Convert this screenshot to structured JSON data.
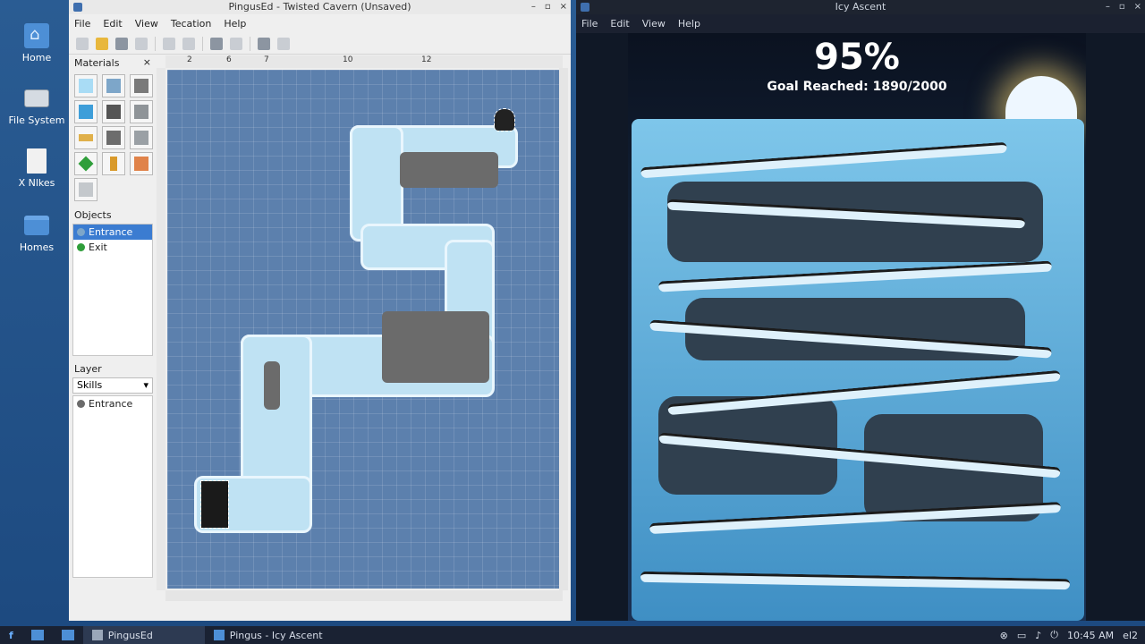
{
  "desktop": {
    "icons": [
      {
        "label": "Home",
        "icon": "home-icon"
      },
      {
        "label": "File System",
        "icon": "drive-icon"
      },
      {
        "label": "X Nlkes",
        "icon": "file-icon"
      },
      {
        "label": "Homes",
        "icon": "folder-icon"
      }
    ]
  },
  "editor": {
    "title": "PingusEd - Twisted Cavern (Unsaved)",
    "menu": [
      "File",
      "Edit",
      "View",
      "Tecation",
      "Help"
    ],
    "materials_title": "Materials",
    "materials_close": "×",
    "objects_title": "Objects",
    "objects": [
      {
        "label": "Entrance",
        "selected": true
      },
      {
        "label": "Exit",
        "selected": false
      }
    ],
    "layer_title": "Layer",
    "layer_dropdown": "Skills",
    "layer_items": [
      "Entrance"
    ],
    "ruler_ticks": [
      "2",
      "6",
      "7",
      "10",
      "12"
    ]
  },
  "game": {
    "title": "Icy Ascent",
    "menu": [
      "File",
      "Edit",
      "View",
      "Help"
    ],
    "percent": "95%",
    "goal": "Goal Reached: 1890/2000"
  },
  "window_controls": [
    "–",
    "▫",
    "×"
  ],
  "taskbar": {
    "start": "f",
    "apps": [
      {
        "label": "PingusEd",
        "active": true
      },
      {
        "label": "Pingus - Icy Ascent",
        "active": false
      }
    ],
    "time": "10:45 AM",
    "extra": "el2"
  },
  "colors": {
    "desktop": "#1f4f86",
    "selection": "#3b7cd1",
    "grid": "#5c80ad",
    "ice": "#bfe2f3"
  }
}
